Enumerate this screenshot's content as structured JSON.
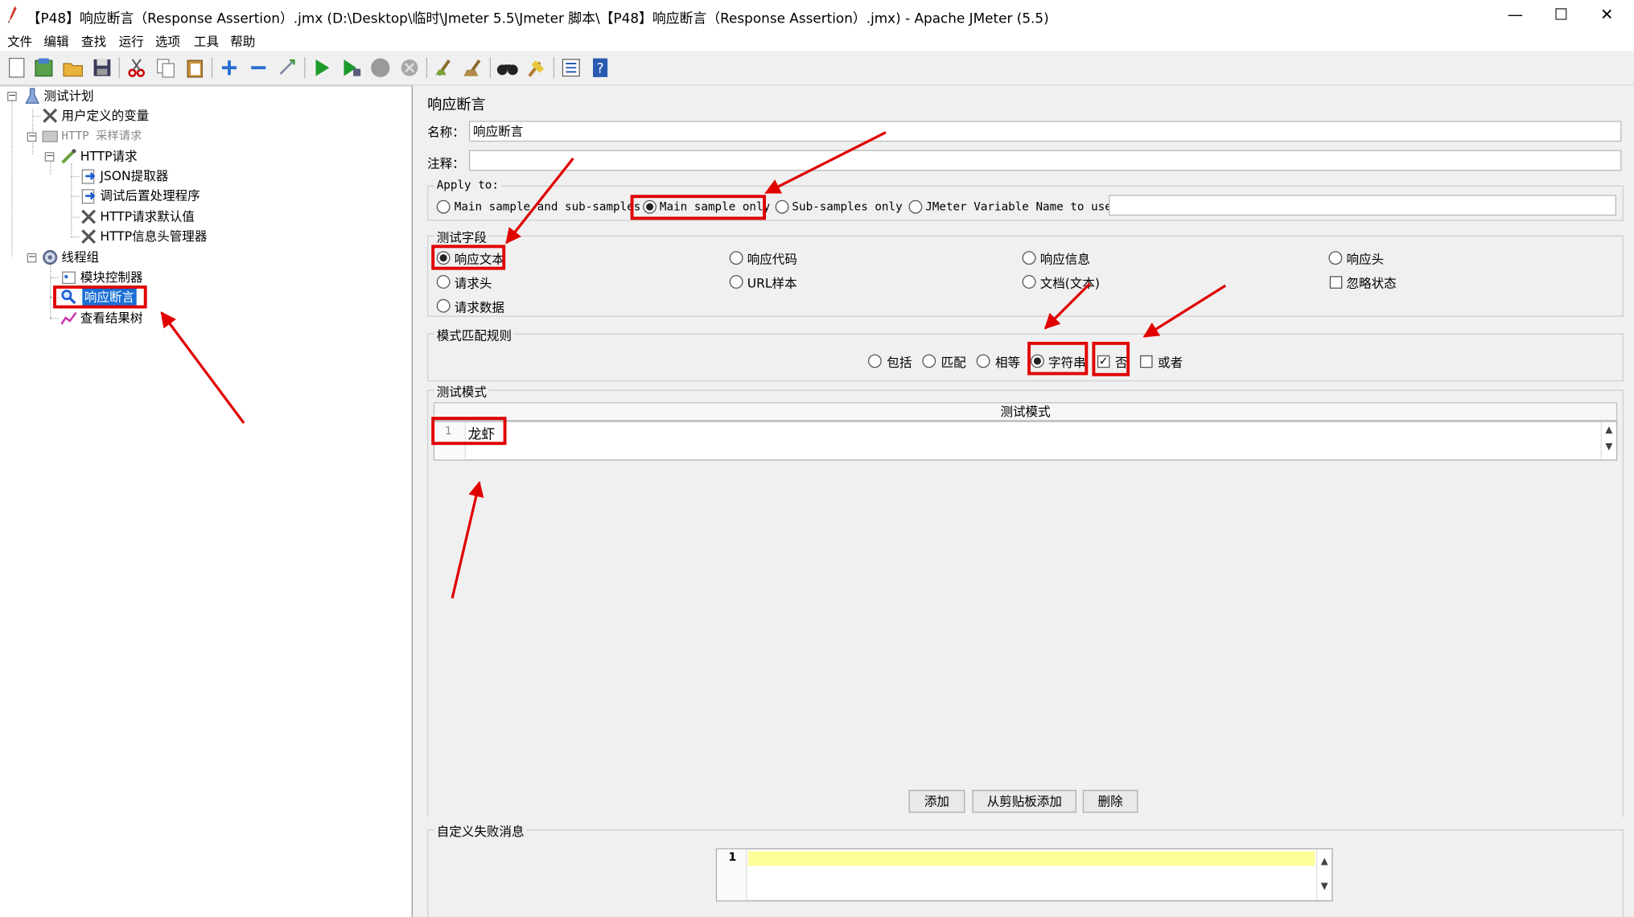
{
  "window": {
    "title": "【P48】响应断言（Response Assertion）.jmx (D:\\Desktop\\临时\\Jmeter 5.5\\Jmeter 脚本\\【P48】响应断言（Response Assertion）.jmx) - Apache JMeter (5.5)",
    "minimize": "—",
    "maximize": "☐",
    "close": "✕"
  },
  "menu": [
    "文件",
    "编辑",
    "查找",
    "运行",
    "选项",
    "工具",
    "帮助"
  ],
  "toolbar": {
    "icons": [
      "new-icon",
      "templates-icon",
      "open-icon",
      "save-icon",
      "cut-icon",
      "copy-icon",
      "paste-icon",
      "expand-icon",
      "collapse-icon",
      "toggle-icon",
      "start-icon",
      "start-no-pause-icon",
      "stop-icon",
      "shutdown-icon",
      "clear-icon",
      "clear-all-icon",
      "search-icon",
      "reset-search-icon",
      "function-helper-icon",
      "help-icon"
    ]
  },
  "tree": {
    "items": [
      {
        "label": "测试计划",
        "icon": "test-plan-icon"
      },
      {
        "label": "用户定义的变量",
        "icon": "config-icon"
      },
      {
        "label": "HTTP 采样请求",
        "icon": "disabled-sampler-icon"
      },
      {
        "label": "HTTP请求",
        "icon": "sampler-icon"
      },
      {
        "label": "JSON提取器",
        "icon": "post-processor-icon"
      },
      {
        "label": "调试后置处理程序",
        "icon": "post-processor-icon"
      },
      {
        "label": "HTTP请求默认值",
        "icon": "config-icon"
      },
      {
        "label": "HTTP信息头管理器",
        "icon": "config-icon"
      },
      {
        "label": "线程组",
        "icon": "thread-group-icon"
      },
      {
        "label": "模块控制器",
        "icon": "controller-icon"
      },
      {
        "label": "响应断言",
        "icon": "assertion-icon"
      },
      {
        "label": "查看结果树",
        "icon": "listener-icon"
      }
    ],
    "selected": "响应断言"
  },
  "panel": {
    "title": "响应断言",
    "name_label": "名称：",
    "name_value": "响应断言",
    "comment_label": "注释：",
    "comment_value": "",
    "apply_to": {
      "legend": "Apply to:",
      "options": [
        "Main sample and sub-samples",
        "Main sample only",
        "Sub-samples only",
        "JMeter Variable Name to use"
      ],
      "selected": "Main sample only",
      "variable_value": ""
    },
    "field_to_test": {
      "legend": "测试字段",
      "options": [
        "响应文本",
        "响应代码",
        "响应信息",
        "响应头",
        "请求头",
        "URL样本",
        "文档(文本)",
        "请求数据"
      ],
      "selected": "响应文本",
      "ignore_status_label": "忽略状态",
      "ignore_status_checked": false
    },
    "pattern_matching": {
      "legend": "模式匹配规则",
      "options": [
        "包括",
        "匹配",
        "相等",
        "字符串"
      ],
      "selected": "字符串",
      "not_label": "否",
      "not_checked": true,
      "or_label": "或者",
      "or_checked": false
    },
    "patterns": {
      "legend": "测试模式",
      "column_header": "测试模式",
      "rows": [
        {
          "line": "1",
          "value": "龙虾"
        }
      ]
    },
    "buttons": {
      "add": "添加",
      "add_from_clipboard": "从剪贴板添加",
      "delete": "删除"
    },
    "custom_failure": {
      "legend": "自定义失败消息",
      "line": "1",
      "value": ""
    }
  },
  "colors": {
    "annotation": "#e00000",
    "selection": "#1a6fd6",
    "editor_highlight": "#ffff99"
  }
}
